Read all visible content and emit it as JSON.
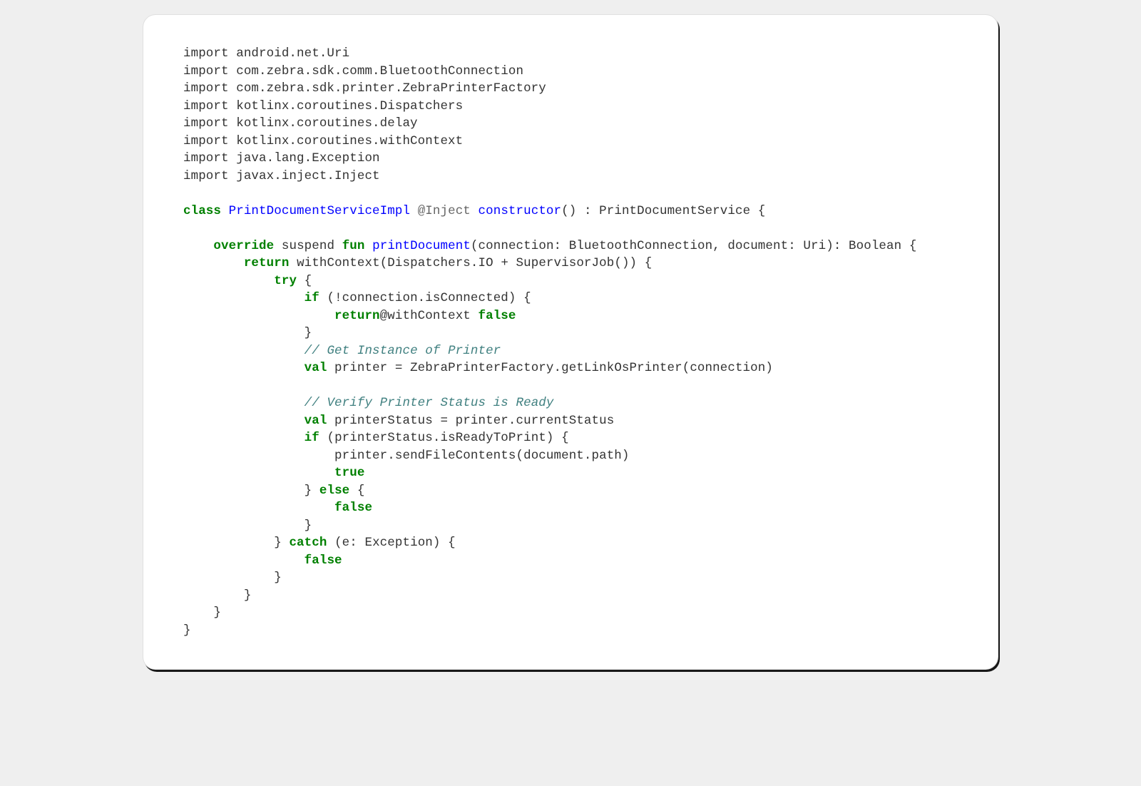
{
  "code": {
    "imports": [
      "import android.net.Uri",
      "import com.zebra.sdk.comm.BluetoothConnection",
      "import com.zebra.sdk.printer.ZebraPrinterFactory",
      "import kotlinx.coroutines.Dispatchers",
      "import kotlinx.coroutines.delay",
      "import kotlinx.coroutines.withContext",
      "import java.lang.Exception",
      "import javax.inject.Inject"
    ],
    "class_kw": "class",
    "class_name": "PrintDocumentServiceImpl",
    "inject_ann": "@Inject",
    "constructor_kw": "constructor",
    "class_sig_tail": "() : PrintDocumentService {",
    "override_kw": "override",
    "suspend_kw": "suspend",
    "fun_kw": "fun",
    "method_name": "printDocument",
    "method_params": "(connection: BluetoothConnection, document: Uri): Boolean {",
    "return_kw": "return",
    "withContext": "withContext",
    "withContext_args": "(Dispatchers.IO + SupervisorJob()) {",
    "try_kw": "try",
    "if_kw": "if",
    "if_cond1": " (!connection.isConnected) {",
    "return_at": "return",
    "at_label": "@withContext ",
    "false_kw": "false",
    "true_kw": "true",
    "close_brace": "}",
    "comment1": "// Get Instance of Printer",
    "val_kw": "val",
    "printer_line": " printer = ZebraPrinterFactory.getLinkOsPrinter(connection)",
    "comment2": "// Verify Printer Status is Ready",
    "printerStatus_line": " printerStatus = printer.currentStatus",
    "if_cond2": " (printerStatus.isReadyToPrint) {",
    "sendFile_line": "printer.sendFileContents(document.path)",
    "else_kw": "else",
    "catch_kw": "catch",
    "catch_params": " (e: Exception) {"
  }
}
